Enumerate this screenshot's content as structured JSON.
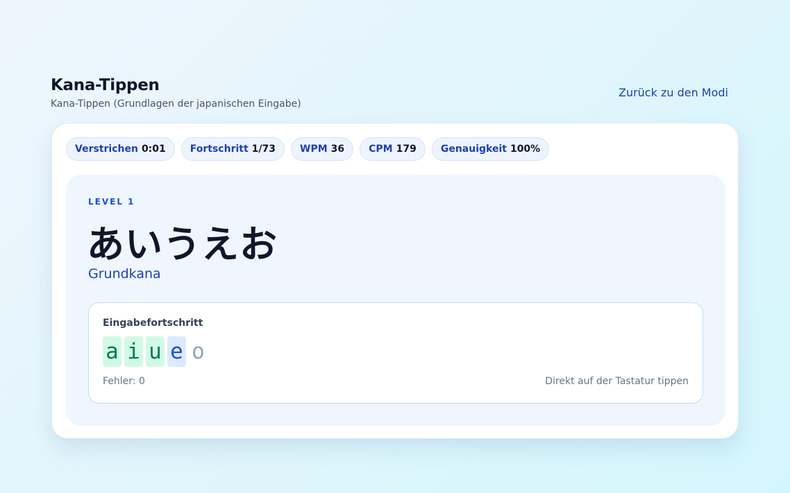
{
  "header": {
    "title": "Kana-Tippen",
    "subtitle": "Kana-Tippen (Grundlagen der japanischen Eingabe)",
    "back_link": "Zurück zu den Modi"
  },
  "stats": [
    {
      "label": "Verstrichen",
      "value": "0:01"
    },
    {
      "label": "Fortschritt",
      "value": "1/73"
    },
    {
      "label": "WPM",
      "value": "36"
    },
    {
      "label": "CPM",
      "value": "179"
    },
    {
      "label": "Genauigkeit",
      "value": "100%"
    }
  ],
  "stage": {
    "level": "LEVEL 1",
    "kana": "あいうえお",
    "meaning": "Grundkana"
  },
  "input": {
    "label": "Eingabefortschritt",
    "chars": [
      {
        "char": "a",
        "state": "done"
      },
      {
        "char": "i",
        "state": "done"
      },
      {
        "char": "u",
        "state": "done"
      },
      {
        "char": "e",
        "state": "current"
      },
      {
        "char": "o",
        "state": "pending"
      }
    ],
    "errors": "Fehler: 0",
    "hint": "Direkt auf der Tastatur tippen"
  },
  "colors": {
    "accent": "#1e40af",
    "done_bg": "#d1fae5",
    "done_fg": "#047857",
    "current_bg": "#dbeafe",
    "current_fg": "#1d4ed8",
    "pending_fg": "#94a3b8"
  }
}
